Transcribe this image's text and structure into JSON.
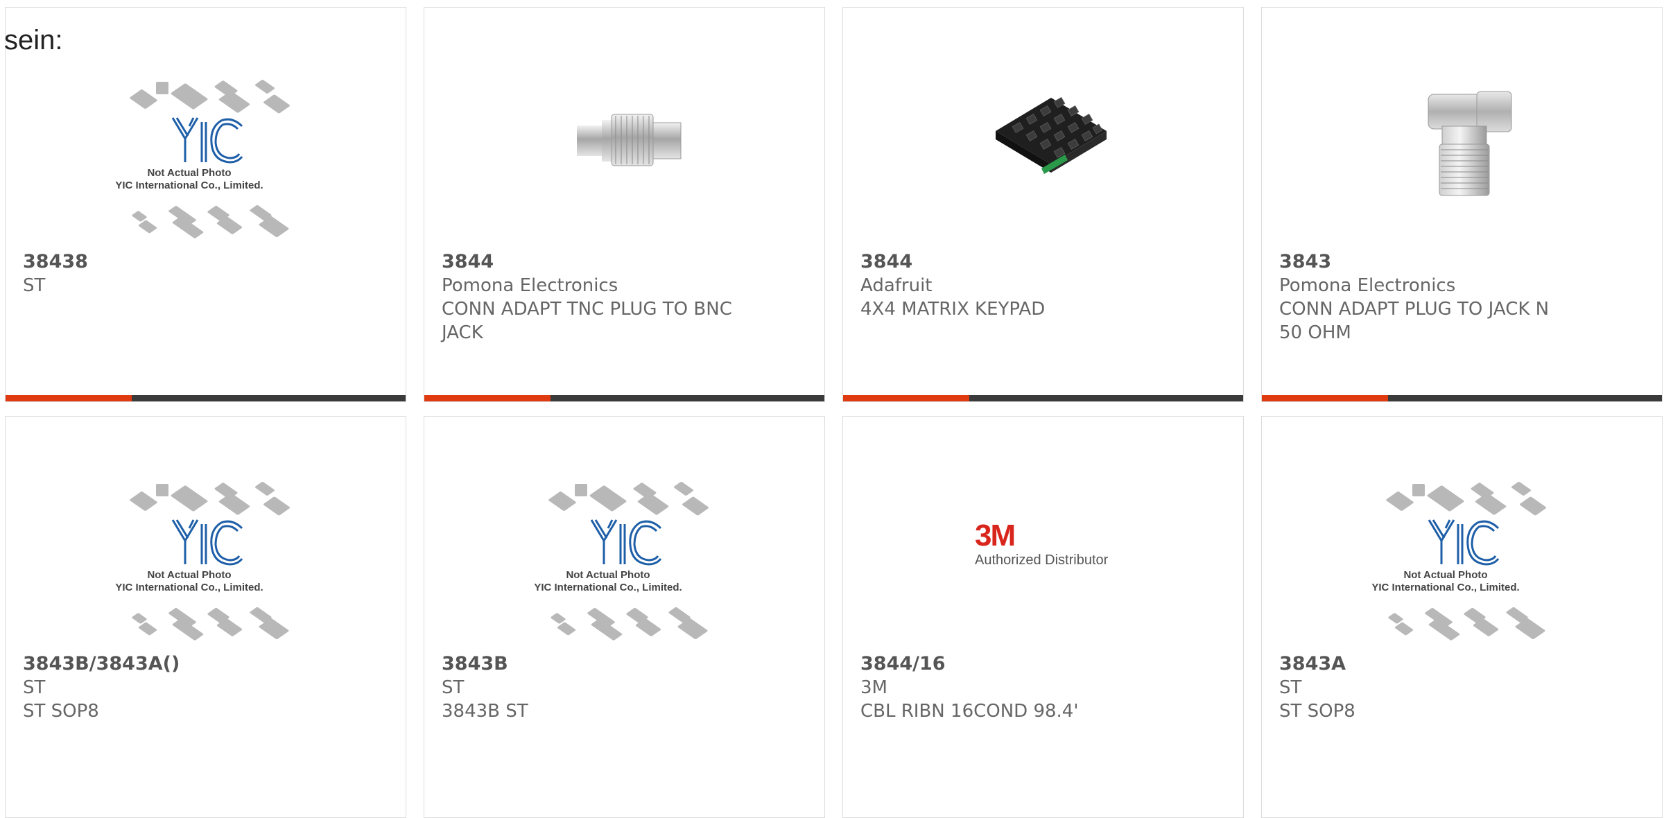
{
  "page_label": "sein:",
  "colors": {
    "accent": "#e03a10",
    "bar": "#3a3a3a",
    "border": "#dcdcdc",
    "brand_3m": "#d9261c",
    "yic_blue": "#1e5fa8"
  },
  "placeholder": {
    "line1": "Not Actual Photo",
    "line2": "YIC International Co., Limited."
  },
  "brand_3m": {
    "logo": "3M",
    "text": "Authorized Distributor"
  },
  "products": [
    {
      "part": "38438",
      "manufacturer": "ST",
      "description": "",
      "image": "yic-placeholder"
    },
    {
      "part": "3844",
      "manufacturer": "Pomona Electronics",
      "description": "CONN ADAPT TNC PLUG TO BNC JACK",
      "image": "tnc-bnc-adapter-photo"
    },
    {
      "part": "3844",
      "manufacturer": "Adafruit",
      "description": "4X4 MATRIX KEYPAD",
      "image": "keypad-photo"
    },
    {
      "part": "3843",
      "manufacturer": "Pomona Electronics",
      "description": "CONN ADAPT PLUG TO JACK N 50 OHM",
      "image": "right-angle-n-adapter-photo"
    },
    {
      "part": "3843B/3843A()",
      "manufacturer": "ST",
      "description": "ST SOP8",
      "image": "yic-placeholder"
    },
    {
      "part": "3843B",
      "manufacturer": "ST",
      "description": "3843B ST",
      "image": "yic-placeholder"
    },
    {
      "part": "3844/16",
      "manufacturer": "3M",
      "description": "CBL RIBN 16COND 98.4'",
      "image": "3m-authorized-distributor"
    },
    {
      "part": "3843A",
      "manufacturer": "ST",
      "description": "ST SOP8",
      "image": "yic-placeholder"
    }
  ]
}
